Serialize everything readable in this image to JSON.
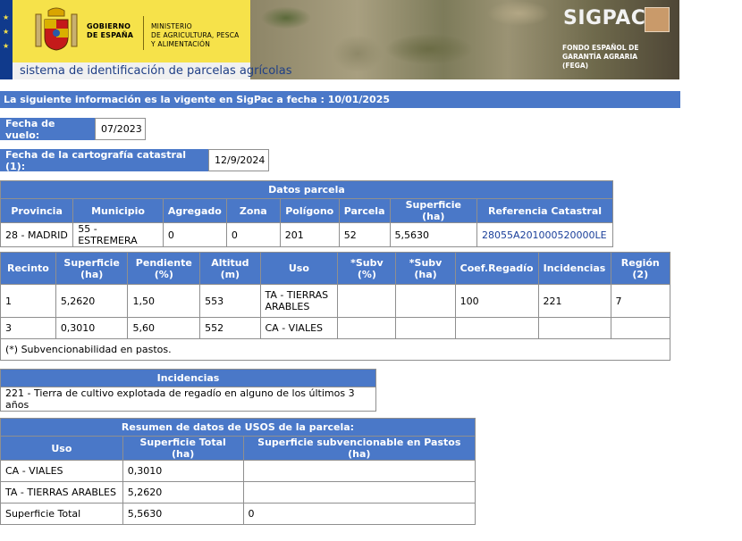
{
  "header": {
    "gov_line1": "GOBIERNO",
    "gov_line2": "DE ESPAÑA",
    "ministry_line1": "MINISTERIO",
    "ministry_line2": "DE AGRICULTURA, PESCA",
    "ministry_line3": "Y ALIMENTACIÓN",
    "subtitle": "sistema de identificación de parcelas agrícolas",
    "sigpac_logo": "SIGPAC",
    "fega_line1": "FONDO ESPAÑOL DE",
    "fega_line2": "GARANTÍA AGRARIA",
    "fega_line3": "(FEGA)"
  },
  "info": "La siguiente información es la vigente en SigPac a fecha : 10/01/2025",
  "vuelo": {
    "label": "Fecha de vuelo:",
    "value": "07/2023"
  },
  "cartografia": {
    "label": "Fecha de la cartografía catastral (1):",
    "value": "12/9/2024"
  },
  "parcela": {
    "title": "Datos parcela",
    "headers": [
      "Provincia",
      "Municipio",
      "Agregado",
      "Zona",
      "Polígono",
      "Parcela",
      "Superficie (ha)",
      "Referencia Catastral"
    ],
    "row": [
      "28 - MADRID",
      "55 - ESTREMERA",
      "0",
      "0",
      "201",
      "52",
      "5,5630",
      "28055A201000520000LE"
    ]
  },
  "recintos": {
    "headers": [
      "Recinto",
      "Superficie (ha)",
      "Pendiente (%)",
      "Altitud (m)",
      "Uso",
      "*Subv (%)",
      "*Subv (ha)",
      "Coef.Regadío",
      "Incidencias",
      "Región (2)"
    ],
    "rows": [
      [
        "1",
        "5,2620",
        "1,50",
        "553",
        "TA - TIERRAS ARABLES",
        "",
        "",
        "100",
        "221",
        "7"
      ],
      [
        "3",
        "0,3010",
        "5,60",
        "552",
        "CA - VIALES",
        "",
        "",
        "",
        "",
        ""
      ]
    ],
    "footnote": "(*) Subvencionabilidad en pastos."
  },
  "incidencias": {
    "title": "Incidencias",
    "text": "221 - Tierra de cultivo explotada de regadío en alguno de los últimos 3 años"
  },
  "usos": {
    "title": "Resumen de datos de USOS de la parcela:",
    "headers": [
      "Uso",
      "Superficie Total (ha)",
      "Superficie subvencionable en Pastos (ha)"
    ],
    "rows": [
      [
        "CA - VIALES",
        "0,3010",
        ""
      ],
      [
        "TA - TIERRAS ARABLES",
        "5,2620",
        ""
      ],
      [
        "Superficie Total",
        "5,5630",
        "0"
      ]
    ]
  },
  "colors": {
    "header_blue": "#4a78c8",
    "gov_yellow": "#f6e24a",
    "eu_blue": "#103a8c"
  }
}
